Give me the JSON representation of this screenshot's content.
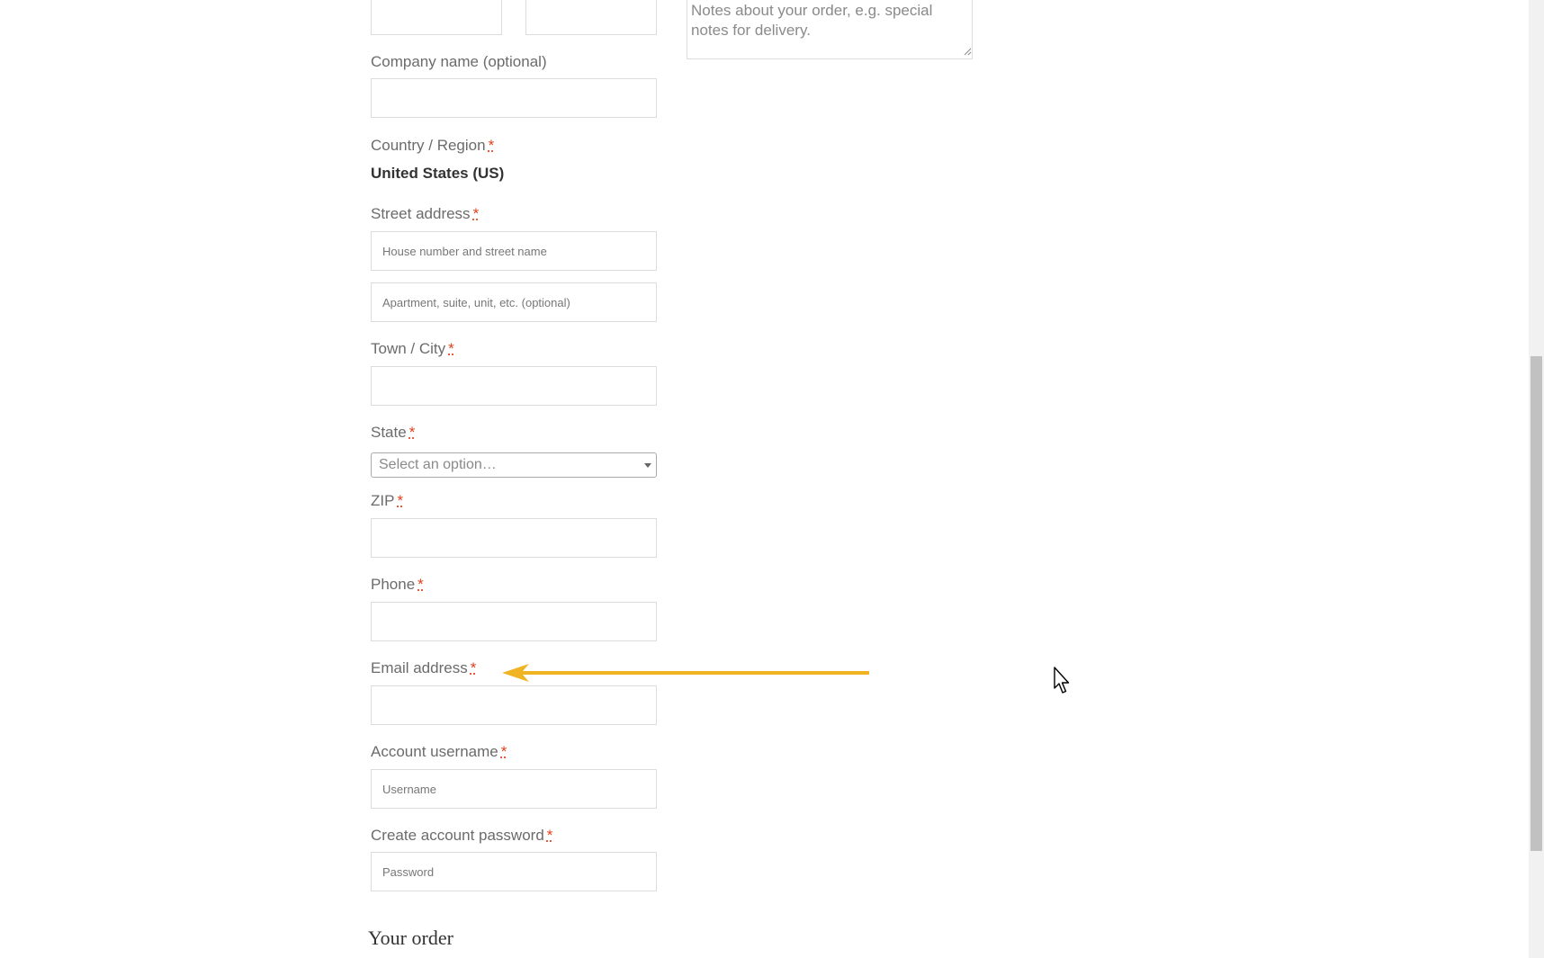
{
  "billing": {
    "company_label": "Company name (optional)",
    "country_label": "Country / Region",
    "country_value": "United States (US)",
    "street_label": "Street address",
    "street_line1_placeholder": "House number and street name",
    "street_line2_placeholder": "Apartment, suite, unit, etc. (optional)",
    "city_label": "Town / City",
    "state_label": "State",
    "state_placeholder": "Select an option…",
    "zip_label": "ZIP",
    "phone_label": "Phone",
    "email_label": "Email address",
    "username_label": "Account username",
    "username_placeholder": "Username",
    "password_label": "Create account password",
    "password_placeholder": "Password",
    "required_marker": "*"
  },
  "additional": {
    "notes_placeholder": "Notes about your order, e.g. special notes for delivery."
  },
  "order": {
    "heading": "Your order"
  },
  "colors": {
    "required": "#e2401c",
    "annotation_arrow": "#f0b323",
    "label": "#6b6b6b"
  },
  "icons": {
    "annotation": "arrow-left-icon",
    "cursor": "mouse-pointer-icon",
    "state_dropdown": "chevron-down-icon"
  }
}
